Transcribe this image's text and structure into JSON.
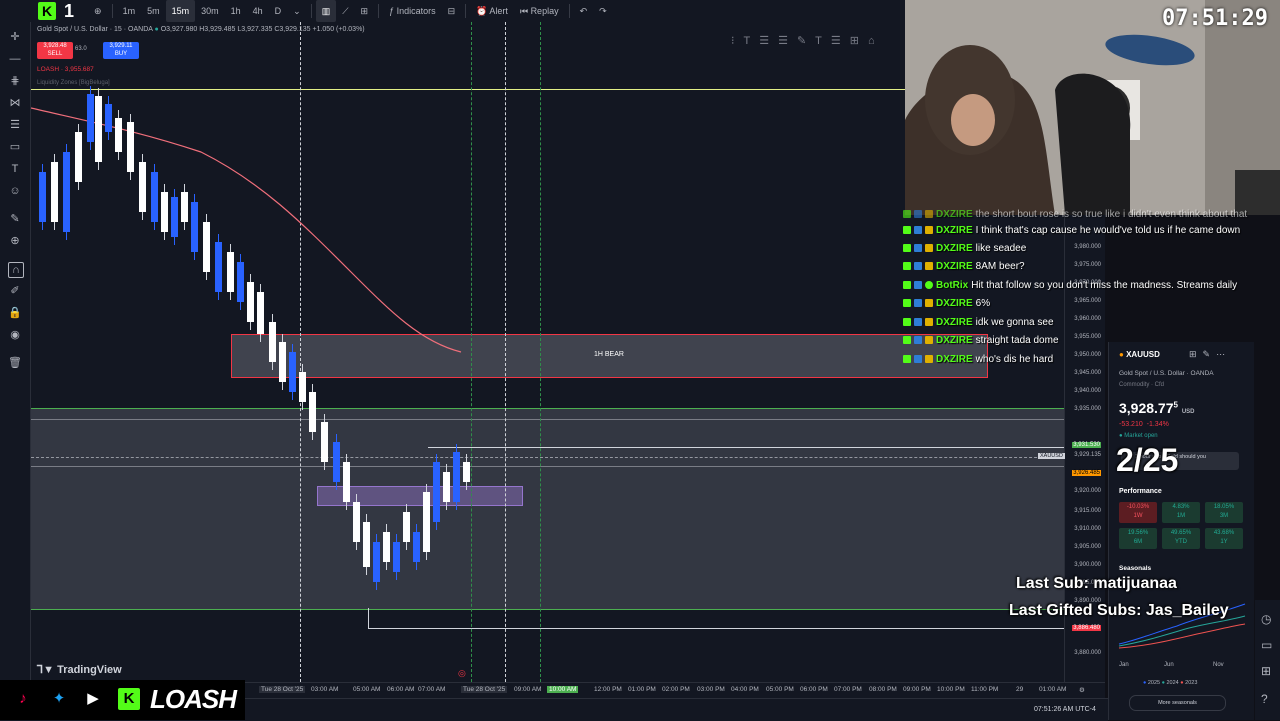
{
  "toolbar": {
    "brand_number": "1",
    "timeframes": [
      "1m",
      "5m",
      "15m",
      "1h",
      "4h",
      "D"
    ],
    "active_timeframe": "15m",
    "indicators_label": "Indicators",
    "alert_label": "Alert",
    "replay_label": "Replay"
  },
  "symbol_header": {
    "title": "Gold Spot / U.S. Dollar · 15 · OANDA",
    "ohlc": "O3,927.980 H3,929.485 L3,927.335 C3,929.135 +1.050 (+0.03%)",
    "sell_price": "3,928.48",
    "sell_label": "SELL",
    "spread": "63.0",
    "buy_price": "3,929.11",
    "buy_label": "BUY",
    "indicator_line": "LOASH · 3,955.687",
    "indicator2": "Liquidity Zones [BigBeluga]"
  },
  "chart": {
    "zone_label": "1H BEAR",
    "symbol_tag": "XAUUSD",
    "price_ticks": [
      "3,980.000",
      "3,975.000",
      "3,970.000",
      "3,965.000",
      "3,960.000",
      "3,955.000",
      "3,950.000",
      "3,945.000",
      "3,940.000",
      "3,935.000",
      "3,930.000",
      "3,925.000",
      "3,920.000",
      "3,915.000",
      "3,910.000",
      "3,905.000",
      "3,900.000",
      "3,895.000",
      "3,890.000",
      "3,885.000",
      "3,880.000"
    ],
    "current_price_label": "3,929.135",
    "marked_price_top": "3,931.530",
    "marked_price_low": "3,926.485",
    "marked_price_bottom": "3,886.480",
    "time_ticks": [
      "Tue 28 Oct '25",
      "03:00 AM",
      "05:00 AM",
      "06:00 AM",
      "07:00 AM",
      "Tue 28 Oct '25",
      "09:00 AM",
      "10:00 AM",
      "12:00 PM",
      "01:00 PM",
      "02:00 PM",
      "03:00 PM",
      "04:00 PM",
      "05:00 PM",
      "06:00 PM",
      "07:00 PM",
      "08:00 PM",
      "09:00 PM",
      "10:00 PM",
      "11:00 PM",
      "29",
      "01:00 AM"
    ],
    "bottom_status": "07:51:26 AM UTC-4",
    "tv_logo": "TradingView"
  },
  "stream": {
    "clock": "07:51:29",
    "counter": "2/25",
    "last_sub": "Last Sub: matijuanaa",
    "last_gifted": "Last Gifted Subs: Jas_Bailey",
    "channel_name": "LOASH",
    "colors": {
      "kick": "#53fc18",
      "bear_zone": "#f23645",
      "green_line": "#4caf50"
    }
  },
  "chat": [
    {
      "user": "DXZIRE",
      "text": "the short bout rose is so true like i didn't even think about that",
      "color": "#53fc18"
    },
    {
      "user": "DXZIRE",
      "text": "I think that's cap cause he would've told us if he came down",
      "color": "#53fc18"
    },
    {
      "user": "DXZIRE",
      "text": "like seadee",
      "color": "#53fc18"
    },
    {
      "user": "DXZIRE",
      "text": "8AM beer?",
      "color": "#53fc18"
    },
    {
      "user": "BotRix",
      "text": "Hit that follow so you don't miss the madness. Streams daily",
      "color": "#53fc18"
    },
    {
      "user": "DXZIRE",
      "text": "6%",
      "color": "#53fc18"
    },
    {
      "user": "DXZIRE",
      "text": "idk we gonna see",
      "color": "#53fc18"
    },
    {
      "user": "DXZIRE",
      "text": "straight tada dome",
      "color": "#53fc18"
    },
    {
      "user": "DXZIRE",
      "text": "who's dis he hard",
      "color": "#53fc18"
    }
  ],
  "rpanel": {
    "symbol": "XAUUSD",
    "name": "Gold Spot / U.S. Dollar",
    "exchange": "OANDA",
    "category": "Commodity · Cfd",
    "price_main": "3,928.77",
    "price_sup": "5",
    "currency": "USD",
    "change": "-53.210  -1.34%",
    "market_status": "Market open",
    "notice": "1 hour ago · Gold should you",
    "performance_label": "Performance",
    "perf": [
      {
        "val": "-10.03%",
        "per": "1W",
        "neg": true
      },
      {
        "val": "4.83%",
        "per": "1M",
        "neg": false
      },
      {
        "val": "18.05%",
        "per": "3M",
        "neg": false
      },
      {
        "val": "19.56%",
        "per": "6M",
        "neg": false
      },
      {
        "val": "49.65%",
        "per": "YTD",
        "neg": false
      },
      {
        "val": "43.68%",
        "per": "1Y",
        "neg": false
      }
    ],
    "seasonals_label": "Seasonals",
    "seasonal_months": [
      "Jan",
      "Jun",
      "Nov"
    ],
    "seasonal_years": [
      "2025",
      "2024",
      "2023"
    ],
    "more_label": "More seasonals"
  }
}
